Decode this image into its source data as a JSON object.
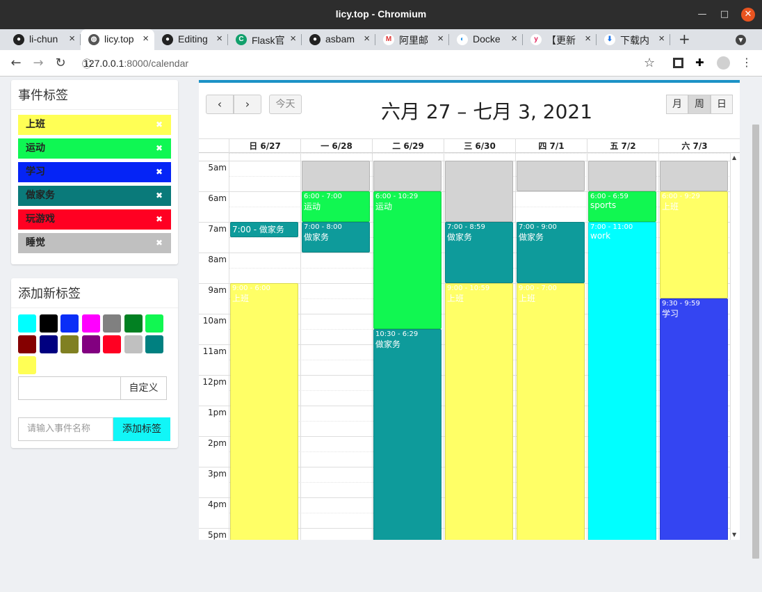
{
  "window": {
    "title": "licy.top - Chromium"
  },
  "tabs": [
    {
      "label": "li-chun",
      "icon": "github-icon",
      "active": false
    },
    {
      "label": "licy.top",
      "icon": "globe-icon",
      "active": true
    },
    {
      "label": "Editing",
      "icon": "github-icon",
      "active": false
    },
    {
      "label": "Flask官",
      "icon": "c-icon",
      "active": false
    },
    {
      "label": "asbam",
      "icon": "github-icon",
      "active": false
    },
    {
      "label": "阿里邮",
      "icon": "mail-icon",
      "active": false
    },
    {
      "label": "Docke",
      "icon": "docker-icon",
      "active": false
    },
    {
      "label": "【更新",
      "icon": "y-icon",
      "active": false
    },
    {
      "label": "下载内",
      "icon": "download-icon",
      "active": false
    }
  ],
  "nav": {
    "url_host": "127.0.0.1",
    "url_rest": ":8000/calendar"
  },
  "sidebar": {
    "tags_title": "事件标签",
    "tags": [
      {
        "label": "上班",
        "color": "#ffff55"
      },
      {
        "label": "运动",
        "color": "#0ff753"
      },
      {
        "label": "学习",
        "color": "#0524f6"
      },
      {
        "label": "做家务",
        "color": "#0a7a7a"
      },
      {
        "label": "玩游戏",
        "color": "#ff0022"
      },
      {
        "label": "睡觉",
        "color": "#c0c0c0"
      }
    ],
    "add_title": "添加新标签",
    "swatches": [
      "#00ffff",
      "#000000",
      "#0a2ef7",
      "#ff00ff",
      "#808080",
      "#028022",
      "#11f751",
      "#850000",
      "#000080",
      "#808022",
      "#820080",
      "#ff0022",
      "#c0c0c0",
      "#008080",
      "#ffff55"
    ],
    "custom_label": "自定义",
    "event_placeholder": "请输入事件名称",
    "add_button": "添加标签"
  },
  "calendar": {
    "title": "六月 27 – 七月 3, 2021",
    "prev": "‹",
    "next": "›",
    "today": "今天",
    "views": [
      "月",
      "周",
      "日"
    ],
    "active_view": "周",
    "days": [
      "日 6/27",
      "一 6/28",
      "二 6/29",
      "三 6/30",
      "四 7/1",
      "五 7/2",
      "六 7/3"
    ],
    "hours": [
      "5am",
      "6am",
      "7am",
      "8am",
      "9am",
      "10am",
      "11am",
      "12pm",
      "1pm",
      "2pm",
      "3pm",
      "4pm",
      "5pm"
    ],
    "events": [
      {
        "day": 1,
        "start": 5.0,
        "end": 6.0,
        "time": "",
        "name": "",
        "color": "#d3d3d3",
        "text": "#333"
      },
      {
        "day": 2,
        "start": 5.0,
        "end": 6.0,
        "time": "",
        "name": "",
        "color": "#d3d3d3",
        "text": "#333"
      },
      {
        "day": 3,
        "start": 5.0,
        "end": 7.0,
        "time": "",
        "name": "",
        "color": "#d3d3d3",
        "text": "#333"
      },
      {
        "day": 4,
        "start": 5.0,
        "end": 6.0,
        "time": "",
        "name": "",
        "color": "#d3d3d3",
        "text": "#333"
      },
      {
        "day": 5,
        "start": 5.0,
        "end": 6.0,
        "time": "",
        "name": "",
        "color": "#d3d3d3",
        "text": "#333"
      },
      {
        "day": 6,
        "start": 5.0,
        "end": 6.0,
        "time": "",
        "name": "",
        "color": "#d3d3d3",
        "text": "#333"
      },
      {
        "day": 0,
        "start": 7.0,
        "end": 7.5,
        "time": "7:00 - 做家务",
        "name": "",
        "color": "#0e9b9b",
        "text": "#fff",
        "inline": true
      },
      {
        "day": 1,
        "start": 6.0,
        "end": 7.0,
        "time": "6:00 - 7:00",
        "name": "运动",
        "color": "#11f751",
        "text": "#fff"
      },
      {
        "day": 1,
        "start": 7.0,
        "end": 8.0,
        "time": "7:00 - 8:00",
        "name": "做家务",
        "color": "#0e9b9b",
        "text": "#fff"
      },
      {
        "day": 2,
        "start": 6.0,
        "end": 10.5,
        "time": "6:00 - 10:29",
        "name": "运动",
        "color": "#11f751",
        "text": "#fff"
      },
      {
        "day": 2,
        "start": 10.5,
        "end": 18.5,
        "time": "10:30 - 6:29",
        "name": "做家务",
        "color": "#0e9b9b",
        "text": "#fff"
      },
      {
        "day": 3,
        "start": 7.0,
        "end": 9.0,
        "time": "7:00 - 8:59",
        "name": "做家务",
        "color": "#0e9b9b",
        "text": "#fff"
      },
      {
        "day": 3,
        "start": 9.0,
        "end": 18.5,
        "time": "9:00 - 10:59",
        "name": "上班",
        "color": "#ffff66",
        "text": "#fff"
      },
      {
        "day": 4,
        "start": 7.0,
        "end": 9.0,
        "time": "7:00 - 9:00",
        "name": "做家务",
        "color": "#0e9b9b",
        "text": "#fff"
      },
      {
        "day": 4,
        "start": 9.0,
        "end": 18.5,
        "time": "9:00 - 7:00",
        "name": "上班",
        "color": "#ffff66",
        "text": "#fff"
      },
      {
        "day": 5,
        "start": 6.0,
        "end": 7.0,
        "time": "6:00 - 6:59",
        "name": "sports",
        "color": "#11f751",
        "text": "#fff"
      },
      {
        "day": 5,
        "start": 7.0,
        "end": 18.5,
        "time": "7:00 - 11:00",
        "name": "work",
        "color": "#00ffff",
        "text": "#fff"
      },
      {
        "day": 6,
        "start": 6.0,
        "end": 9.5,
        "time": "6:00 - 9:29",
        "name": "上班",
        "color": "#ffff66",
        "text": "#fff"
      },
      {
        "day": 6,
        "start": 9.5,
        "end": 18.5,
        "time": "9:30 - 9:59",
        "name": "学习",
        "color": "#3445f2",
        "text": "#fff"
      },
      {
        "day": 0,
        "start": 9.0,
        "end": 18.5,
        "time": "9:00 - 6:00",
        "name": "上班",
        "color": "#ffff66",
        "text": "#fff"
      }
    ]
  }
}
